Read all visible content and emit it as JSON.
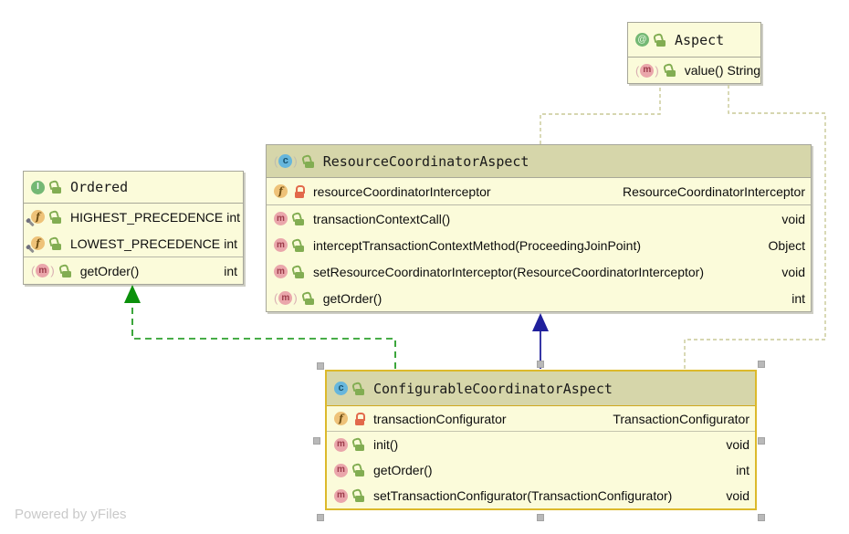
{
  "watermark": "Powered by yFiles",
  "colors": {
    "background": "#ffffff",
    "class_header": "#d6d6aa",
    "node_body": "#fbfbda",
    "node_border": "#a6a69a",
    "selection_border": "#dcb92b",
    "realization_edge": "#0b900b",
    "generalization_edge": "#20209c",
    "annotation_edge": "#c9c996",
    "private_lock": "#e2694b",
    "public_lock": "#82ad52"
  },
  "classes": {
    "aspect": {
      "name": "Aspect",
      "kind": "annotation",
      "members": [
        {
          "name": "value()",
          "type": "String",
          "member_kind": "method-override",
          "visibility": "public"
        }
      ]
    },
    "ordered": {
      "name": "Ordered",
      "kind": "interface",
      "members": [
        {
          "name": "HIGHEST_PRECEDENCE",
          "type": "int",
          "member_kind": "field-static-final",
          "visibility": "public"
        },
        {
          "name": "LOWEST_PRECEDENCE",
          "type": "int",
          "member_kind": "field-static-final",
          "visibility": "public"
        },
        {
          "name": "getOrder()",
          "type": "int",
          "member_kind": "method-override",
          "visibility": "public"
        }
      ]
    },
    "rca": {
      "name": "ResourceCoordinatorAspect",
      "kind": "class",
      "members": [
        {
          "name": "resourceCoordinatorInterceptor",
          "type": "ResourceCoordinatorInterceptor",
          "member_kind": "field",
          "visibility": "private"
        },
        {
          "name": "transactionContextCall()",
          "type": "void",
          "member_kind": "method",
          "visibility": "public"
        },
        {
          "name": "interceptTransactionContextMethod(ProceedingJoinPoint)",
          "type": "Object",
          "member_kind": "method",
          "visibility": "public"
        },
        {
          "name": "setResourceCoordinatorInterceptor(ResourceCoordinatorInterceptor)",
          "type": "void",
          "member_kind": "method",
          "visibility": "public"
        },
        {
          "name": "getOrder()",
          "type": "int",
          "member_kind": "method-override",
          "visibility": "public"
        }
      ]
    },
    "cca": {
      "name": "ConfigurableCoordinatorAspect",
      "kind": "class",
      "selected": true,
      "members": [
        {
          "name": "transactionConfigurator",
          "type": "TransactionConfigurator",
          "member_kind": "field",
          "visibility": "private"
        },
        {
          "name": "init()",
          "type": "void",
          "member_kind": "method",
          "visibility": "public"
        },
        {
          "name": "getOrder()",
          "type": "int",
          "member_kind": "method",
          "visibility": "public"
        },
        {
          "name": "setTransactionConfigurator(TransactionConfigurator)",
          "type": "void",
          "member_kind": "method",
          "visibility": "public"
        }
      ]
    }
  },
  "edges": [
    {
      "type": "realization",
      "from": "ConfigurableCoordinatorAspect",
      "to": "Ordered",
      "style": "dashed",
      "color": "#0b900b"
    },
    {
      "type": "generalization",
      "from": "ConfigurableCoordinatorAspect",
      "to": "ResourceCoordinatorAspect",
      "style": "solid",
      "color": "#20209c"
    },
    {
      "type": "annotation-dependency",
      "from": "ResourceCoordinatorAspect",
      "to": "Aspect",
      "style": "dashed",
      "color": "#c9c996"
    },
    {
      "type": "annotation-dependency",
      "from": "ConfigurableCoordinatorAspect",
      "to": "Aspect",
      "style": "dashed",
      "color": "#c9c996"
    }
  ]
}
